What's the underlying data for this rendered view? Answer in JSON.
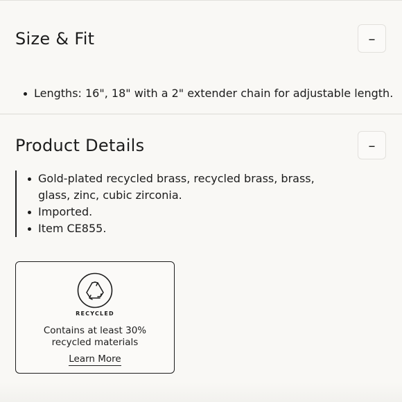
{
  "size_fit": {
    "title": "Size & Fit",
    "toggle_symbol": "–",
    "bullets": [
      "Lengths: 16\", 18\" with a 2\" extender chain for adjustable length."
    ]
  },
  "product_details": {
    "title": "Product Details",
    "toggle_symbol": "–",
    "bullets": [
      "Gold-plated recycled brass, recycled brass, brass, glass, zinc, cubic zirconia.",
      "Imported.",
      "Item CE855."
    ]
  },
  "recycled_card": {
    "icon": "recycle-icon",
    "badge": "RECYCLED",
    "description": "Contains at least 30% recycled materials",
    "link": "Learn More"
  }
}
